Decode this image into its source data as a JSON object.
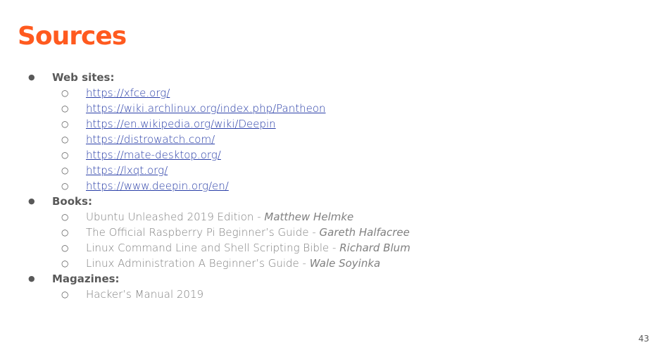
{
  "slide": {
    "title": "Sources",
    "page_number": "43",
    "colors": {
      "title": "#ff5a1f",
      "text": "#595959",
      "muted_text": "#808080",
      "link": "#2a3fa8"
    }
  },
  "sections": {
    "websites": {
      "label": "Web sites:",
      "links": [
        "https://xfce.org/",
        "https://wiki.archlinux.org/index.php/Pantheon",
        "https://en.wikipedia.org/wiki/Deepin",
        "https://distrowatch.com/",
        "https://mate-desktop.org/",
        "https://lxqt.org/",
        "https://www.deepin.org/en/"
      ]
    },
    "books": {
      "label": "Books:",
      "items": [
        {
          "title": "Ubuntu Unleashed 2019 Edition",
          "separator": " - ",
          "author": "Matthew Helmke"
        },
        {
          "title": "The Official Raspberry Pi Beginner’s Guide",
          "separator": " - ",
          "author": "Gareth Halfacree"
        },
        {
          "title": "Linux Command Line and Shell Scripting Bible",
          "separator": " - ",
          "author": "Richard Blum"
        },
        {
          "title": "Linux Administration A Beginner’s Guide",
          "separator": " - ",
          "author": "Wale Soyinka"
        }
      ]
    },
    "magazines": {
      "label": "Magazines:",
      "items": [
        "Hacker’s Manual 2019"
      ]
    }
  },
  "icons": {
    "section_bullet": "●",
    "item_bullet": "○"
  }
}
